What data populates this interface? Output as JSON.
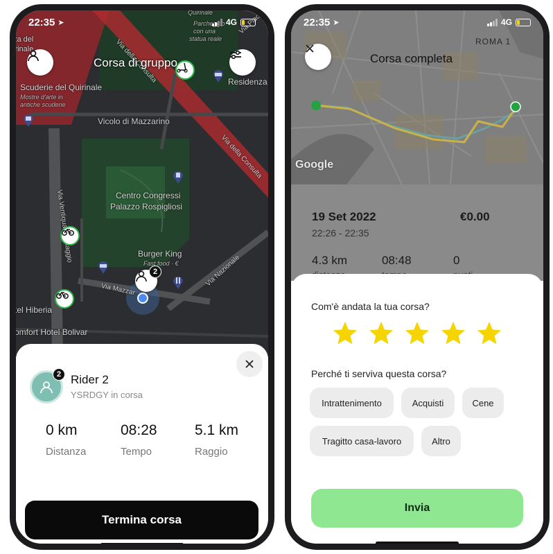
{
  "left": {
    "status": {
      "time": "22:35",
      "network": "4G"
    },
    "map": {
      "title": "Corsa di gruppo",
      "places": {
        "scuderie": "Scuderie del Quirinale",
        "scuderie_sub1": "Mostre d'arte in",
        "scuderie_sub2": "antiche scuderie",
        "quirinale": "irinale",
        "quirinale_top": "za del",
        "parcheggio1": "Quirinale",
        "parcheggio2": "Parcheggio",
        "parcheggio3": "con una",
        "parcheggio4": "statua reale",
        "residenza": "Residenza",
        "centro1": "Centro Congressi",
        "centro2": "Palazzo Rospigliosi",
        "burger": "Burger King",
        "burger_sub": "Fast food · €",
        "hiberia": "tel Hiberia",
        "bolivar": "omfort Hotel Bolivar"
      },
      "streets": {
        "mazzarino": "Vicolo di Mazzarino",
        "consulta1": "Via della Consulta",
        "consulta2": "Via della Consulta",
        "placere": "Via Piacer",
        "ventiquattro": "Via Ventiquattro Maggio",
        "nazionale": "Via Nazionale",
        "mazzarino2": "Via Mazzar"
      },
      "rider_badge": "2"
    },
    "sheet": {
      "rider_name": "Rider 2",
      "rider_status": "YSRDGY in corsa",
      "avatar_badge": "2",
      "stats": [
        {
          "value": "0 km",
          "label": "Distanza"
        },
        {
          "value": "08:28",
          "label": "Tempo"
        },
        {
          "value": "5.1 km",
          "label": "Raggio"
        }
      ],
      "end_button": "Termina corsa"
    }
  },
  "right": {
    "status": {
      "time": "22:35",
      "network": "4G"
    },
    "map": {
      "title": "Corsa completa",
      "watermark": "Google",
      "roma": "ROMA 1"
    },
    "summary": {
      "date": "19 Set 2022",
      "price": "€0.00",
      "time_range": "22:26 - 22:35",
      "distance": "4.3 km",
      "duration": "08:48",
      "count": "0",
      "distance_label": "distanza",
      "duration_label": "tempo",
      "count_label": "punti"
    },
    "rating": {
      "question": "Com'è andata la tua corsa?",
      "stars": 5,
      "reason_question": "Perché ti serviva questa corsa?",
      "chips": [
        "Intrattenimento",
        "Acquisti",
        "Cene",
        "Tragitto casa-lavoro",
        "Altro"
      ],
      "submit": "Invia"
    }
  },
  "colors": {
    "accent_green": "#2eb84a",
    "submit_green": "#8fe791",
    "star_yellow": "#f5d400",
    "zone_red": "#c0392b"
  }
}
